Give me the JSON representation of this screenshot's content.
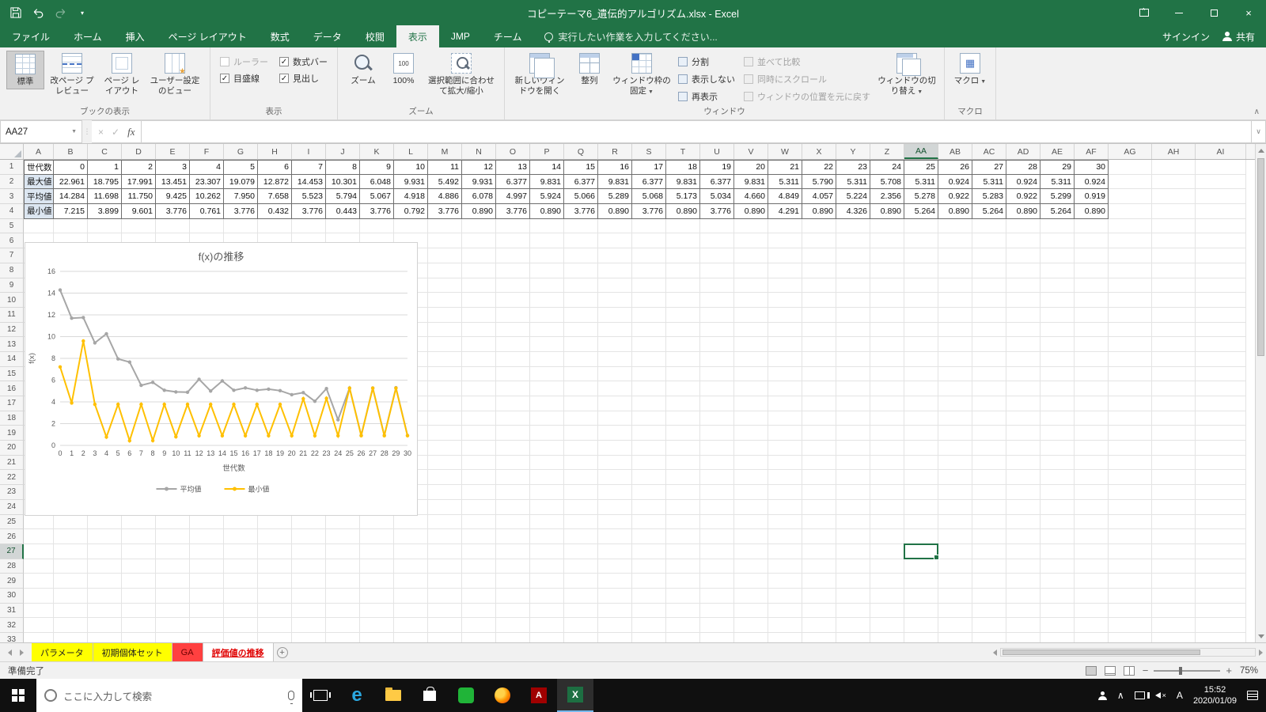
{
  "colors": {
    "accent": "#217346",
    "series_avg": "#a6a6a6",
    "series_min": "#ffc000"
  },
  "titlebar": {
    "title": "コピーテーマ6_遺伝的アルゴリズム.xlsx - Excel"
  },
  "ribbon_tabs": {
    "file": "ファイル",
    "items": [
      "ホーム",
      "挿入",
      "ページ レイアウト",
      "数式",
      "データ",
      "校閲",
      "表示",
      "JMP",
      "チーム"
    ],
    "active": "表示",
    "search": "実行したい作業を入力してください...",
    "signin": "サインイン",
    "share": "共有"
  },
  "ribbon": {
    "book_views": {
      "label": "ブックの表示",
      "normal": "標準",
      "page_break": "改ページ プレビュー",
      "page_layout": "ページ レイアウト",
      "custom": "ユーザー設定のビュー"
    },
    "show": {
      "label": "表示",
      "ruler": "ルーラー",
      "formula_bar": "数式バー",
      "gridlines": "目盛線",
      "headings": "見出し"
    },
    "zoom": {
      "label": "ズーム",
      "zoom": "ズーム",
      "hundred": "100%",
      "fit": "選択範囲に合わせて拡大/縮小"
    },
    "window": {
      "label": "ウィンドウ",
      "new_window": "新しいウィンドウを開く",
      "arrange": "整列",
      "freeze": "ウィンドウ枠の固定",
      "split": "分割",
      "hide": "表示しない",
      "unhide": "再表示",
      "side_by_side": "並べて比較",
      "sync_scroll": "同時にスクロール",
      "reset_position": "ウィンドウの位置を元に戻す",
      "switch": "ウィンドウの切り替え"
    },
    "macros": {
      "label": "マクロ",
      "macros": "マクロ"
    }
  },
  "formula_bar": {
    "name_box": "AA27",
    "fx": "fx",
    "value": ""
  },
  "sheet": {
    "selected_cell": "AA27",
    "selected_col": "AA",
    "selected_row": 27,
    "columns": [
      "A",
      "B",
      "C",
      "D",
      "E",
      "F",
      "G",
      "H",
      "I",
      "J",
      "K",
      "L",
      "M",
      "N",
      "O",
      "P",
      "Q",
      "R",
      "S",
      "T",
      "U",
      "V",
      "W",
      "X",
      "Y",
      "Z",
      "AA",
      "AB",
      "AC",
      "AD",
      "AE",
      "AF",
      "AG",
      "AH",
      "AI"
    ],
    "row_count": 33
  },
  "table": {
    "header_label": "世代数",
    "generations": [
      0,
      1,
      2,
      3,
      4,
      5,
      6,
      7,
      8,
      9,
      10,
      11,
      12,
      13,
      14,
      15,
      16,
      17,
      18,
      19,
      20,
      21,
      22,
      23,
      24,
      25,
      26,
      27,
      28,
      29,
      30
    ],
    "rows": [
      {
        "label": "最大値",
        "values": [
          22.961,
          18.795,
          17.991,
          13.451,
          23.307,
          19.079,
          12.872,
          14.453,
          10.301,
          6.048,
          9.931,
          5.492,
          9.931,
          6.377,
          9.831,
          6.377,
          9.831,
          6.377,
          9.831,
          6.377,
          9.831,
          5.311,
          5.79,
          5.311,
          5.708,
          5.311,
          0.924,
          5.311,
          0.924,
          5.311,
          0.924
        ]
      },
      {
        "label": "平均値",
        "values": [
          14.284,
          11.698,
          11.75,
          9.425,
          10.262,
          7.95,
          7.658,
          5.523,
          5.794,
          5.067,
          4.918,
          4.886,
          6.078,
          4.997,
          5.924,
          5.066,
          5.289,
          5.068,
          5.173,
          5.034,
          4.66,
          4.849,
          4.057,
          5.224,
          2.356,
          5.278,
          0.922,
          5.283,
          0.922,
          5.299,
          0.919
        ]
      },
      {
        "label": "最小値",
        "values": [
          7.215,
          3.899,
          9.601,
          3.776,
          0.761,
          3.776,
          0.432,
          3.776,
          0.443,
          3.776,
          0.792,
          3.776,
          0.89,
          3.776,
          0.89,
          3.776,
          0.89,
          3.776,
          0.89,
          3.776,
          0.89,
          4.291,
          0.89,
          4.326,
          0.89,
          5.264,
          0.89,
          5.264,
          0.89,
          5.264,
          0.89
        ]
      }
    ]
  },
  "chart_data": {
    "type": "line",
    "title": "f(x)の推移",
    "xlabel": "世代数",
    "ylabel": "f(x)",
    "x": [
      0,
      1,
      2,
      3,
      4,
      5,
      6,
      7,
      8,
      9,
      10,
      11,
      12,
      13,
      14,
      15,
      16,
      17,
      18,
      19,
      20,
      21,
      22,
      23,
      24,
      25,
      26,
      27,
      28,
      29,
      30
    ],
    "ylim": [
      0,
      16
    ],
    "yticks": [
      0,
      2,
      4,
      6,
      8,
      10,
      12,
      14,
      16
    ],
    "grid": true,
    "legend_position": "bottom",
    "series": [
      {
        "name": "平均値",
        "color": "#a6a6a6",
        "values": [
          14.284,
          11.698,
          11.75,
          9.425,
          10.262,
          7.95,
          7.658,
          5.523,
          5.794,
          5.067,
          4.918,
          4.886,
          6.078,
          4.997,
          5.924,
          5.066,
          5.289,
          5.068,
          5.173,
          5.034,
          4.66,
          4.849,
          4.057,
          5.224,
          2.356,
          5.278,
          0.922,
          5.283,
          0.922,
          5.299,
          0.919
        ]
      },
      {
        "name": "最小値",
        "color": "#ffc000",
        "values": [
          7.215,
          3.899,
          9.601,
          3.776,
          0.761,
          3.776,
          0.432,
          3.776,
          0.443,
          3.776,
          0.792,
          3.776,
          0.89,
          3.776,
          0.89,
          3.776,
          0.89,
          3.776,
          0.89,
          3.776,
          0.89,
          4.291,
          0.89,
          4.326,
          0.89,
          5.264,
          0.89,
          5.264,
          0.89,
          5.264,
          0.89
        ]
      }
    ]
  },
  "sheet_tabs": {
    "tabs": [
      {
        "label": "パラメータ",
        "bg": "#ffff00",
        "text": "#1f1f1f",
        "active": false
      },
      {
        "label": "初期個体セット",
        "bg": "#ffff00",
        "text": "#1f1f1f",
        "active": false
      },
      {
        "label": "GA",
        "bg": "#ff4040",
        "text": "#6b0000",
        "active": false
      },
      {
        "label": "評価値の推移",
        "bg": "#ffffff",
        "text": "#e00000",
        "active": true
      }
    ]
  },
  "status_bar": {
    "status": "準備完了",
    "zoom": "75%"
  },
  "taskbar": {
    "search_placeholder": "ここに入力して検索",
    "time": "15:52",
    "date": "2020/01/09",
    "ime": "A"
  }
}
